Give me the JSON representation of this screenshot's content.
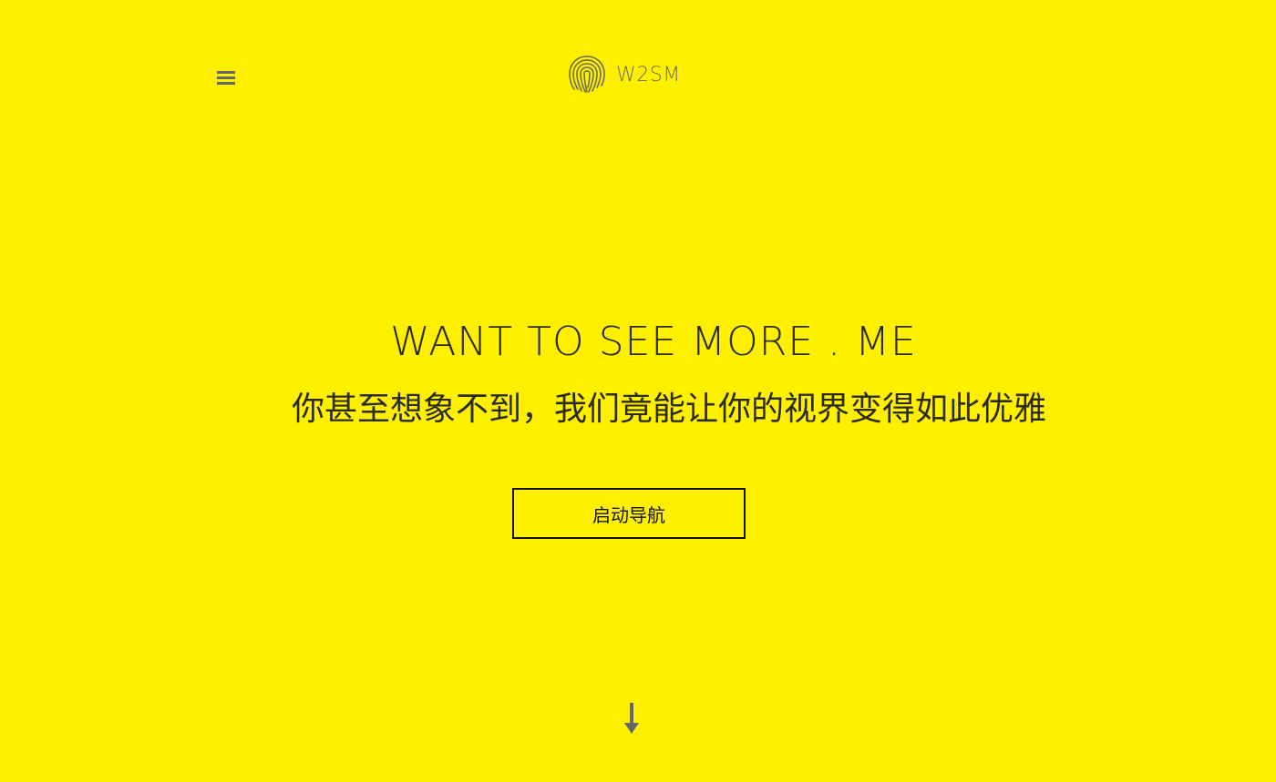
{
  "header": {
    "menu_icon": "hamburger-menu-icon",
    "logo_icon": "fingerprint-icon",
    "brand_name": "W2SM"
  },
  "hero": {
    "title": "WANT TO SEE MORE . ME",
    "subtitle": "你甚至想象不到，我们竟能让你的视界变得如此优雅",
    "cta_label": "启动导航",
    "scroll_icon": "arrow-down-icon"
  },
  "colors": {
    "background": "#FFF000",
    "text_dark": "#2b2b1e",
    "icon_gray": "#666666",
    "button_border": "#111111"
  }
}
